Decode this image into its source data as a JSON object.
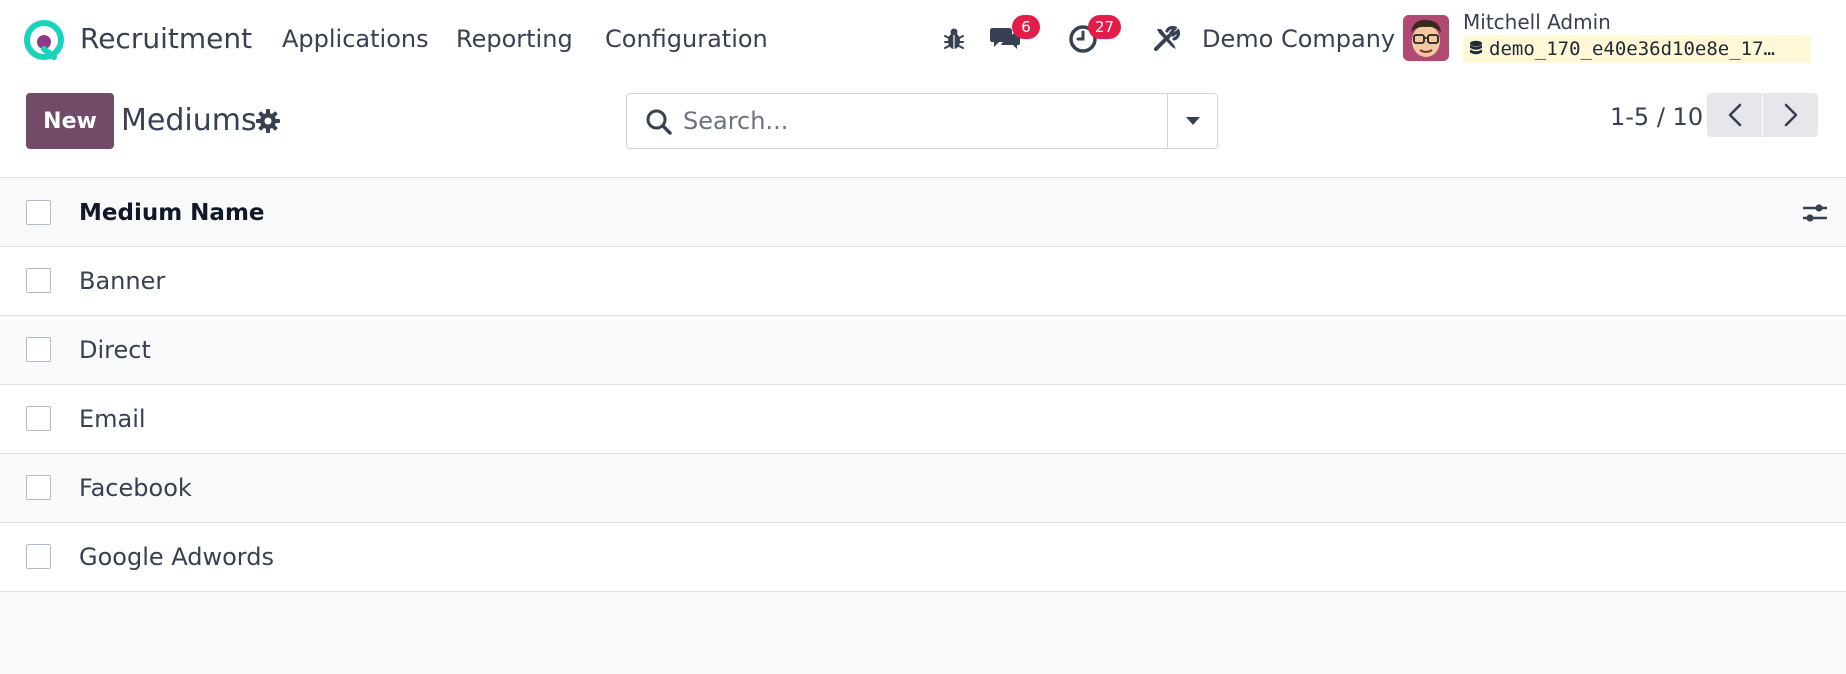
{
  "navbar": {
    "app_title": "Recruitment",
    "menu": [
      {
        "label": "Applications"
      },
      {
        "label": "Reporting"
      },
      {
        "label": "Configuration"
      }
    ],
    "messages_count": "6",
    "activities_count": "27",
    "company": "Demo Company",
    "user_name": "Mitchell Admin",
    "database": "demo_170_e40e36d10e8e_17…"
  },
  "control": {
    "new_label": "New",
    "title": "Mediums",
    "search_placeholder": "Search...",
    "pager_value": "1-5 / 10"
  },
  "list": {
    "column_header": "Medium Name",
    "rows": [
      {
        "name": "Banner"
      },
      {
        "name": "Direct"
      },
      {
        "name": "Email"
      },
      {
        "name": "Facebook"
      },
      {
        "name": "Google Adwords"
      }
    ]
  },
  "colors": {
    "primary": "#714b67",
    "badge": "#e11d48",
    "logo_green": "#1ad3bb",
    "logo_purple": "#8f3a84"
  }
}
